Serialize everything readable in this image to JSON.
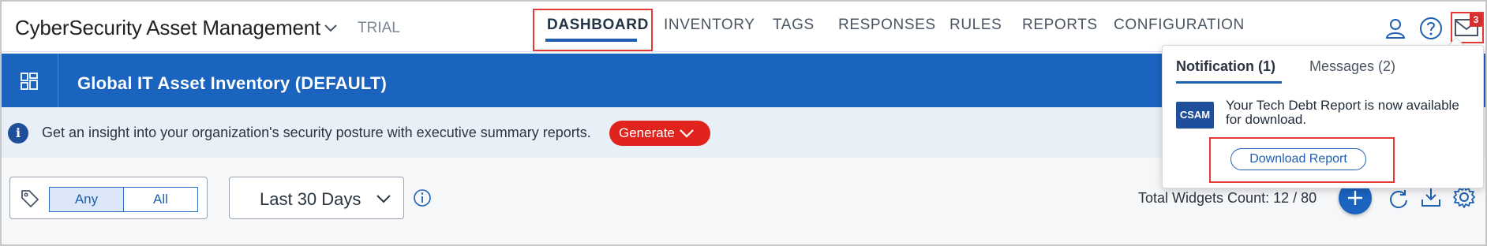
{
  "app": {
    "title": "CyberSecurity Asset Management",
    "edition": "TRIAL"
  },
  "nav": {
    "tabs": [
      {
        "label": "DASHBOARD",
        "active": true
      },
      {
        "label": "INVENTORY",
        "active": false
      },
      {
        "label": "TAGS",
        "active": false
      },
      {
        "label": "RESPONSES",
        "active": false
      },
      {
        "label": "RULES",
        "active": false
      },
      {
        "label": "REPORTS",
        "active": false
      },
      {
        "label": "CONFIGURATION",
        "active": false
      }
    ],
    "icons": [
      "user-icon",
      "help-icon",
      "mail-icon"
    ],
    "mail_badge": "3"
  },
  "header": {
    "title": "Global IT Asset Inventory (DEFAULT)",
    "icon": "dashboard-layout-icon"
  },
  "info_bar": {
    "text": "Get an insight into your organization's security posture with executive summary reports.",
    "generate_label": "Generate"
  },
  "filters": {
    "tag_match": {
      "options": [
        "Any",
        "All"
      ],
      "selected": "Any"
    },
    "date_range": "Last 30 Days",
    "widgets_count": "Total Widgets Count: 12 / 80"
  },
  "notifications": {
    "tabs": [
      {
        "label": "Notification (1)",
        "active": true
      },
      {
        "label": "Messages (2)",
        "active": false
      }
    ],
    "items": [
      {
        "logo": "CSAM",
        "message": "Your Tech Debt Report is now available for download.",
        "action_label": "Download Report"
      }
    ]
  },
  "colors": {
    "primary_blue": "#1a63bf",
    "generate_red": "#e0231c",
    "highlight_red": "#e53935",
    "info_bg": "#e9eff7"
  }
}
